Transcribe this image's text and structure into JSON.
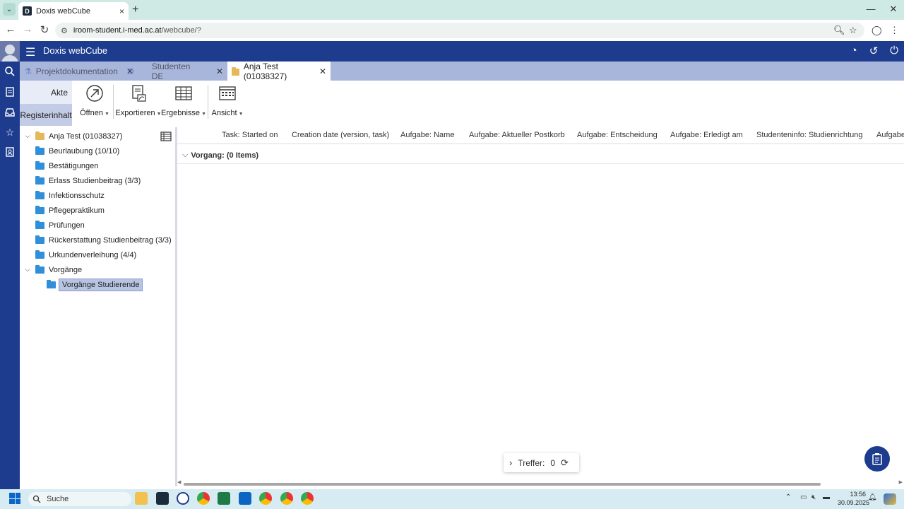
{
  "browser": {
    "tab_title": "Doxis webCube",
    "tab_close": "×",
    "new_tab": "+",
    "url_host": "iroom-student.i-med.ac.at",
    "url_path": "/webcube/?",
    "win_minimize": "—",
    "win_restore": "❐",
    "win_close": "✕"
  },
  "app": {
    "title": "Doxis webCube",
    "tabs": [
      {
        "label": "Projektdokumentation",
        "icon": "flask-icon"
      },
      {
        "label": "Studenten DE",
        "icon": "users-icon"
      },
      {
        "label": "Anja Test (01038327)",
        "icon": "folder-icon"
      }
    ]
  },
  "ribbon": {
    "tab_akte": "Akte",
    "tab_registerinhalt": "Registerinhalt",
    "buttons": [
      {
        "label": "Öffnen",
        "icon": "open-arrow-icon"
      },
      {
        "label": "Exportieren",
        "icon": "export-pdf-icon"
      },
      {
        "label": "Ergebnisse",
        "icon": "table-icon"
      },
      {
        "label": "Ansicht",
        "icon": "calendar-view-icon"
      }
    ]
  },
  "tree": {
    "root": "Anja Test (01038327)",
    "items": [
      "Beurlaubung (10/10)",
      "Bestätigungen",
      "Erlass Studienbeitrag (3/3)",
      "Infektionsschutz",
      "Pflegepraktikum",
      "Prüfungen",
      "Rückerstattung Studienbeitrag (3/3)",
      "Urkundenverleihung (4/4)",
      "Vorgänge"
    ],
    "selected_child": "Vorgänge Studierende"
  },
  "grid": {
    "columns": [
      "Task: Started on",
      "Creation date (version, task)",
      "Aufgabe: Name",
      "Aufgabe: Aktueller Postkorb",
      "Aufgabe: Entscheidung",
      "Aufgabe: Erledigt am",
      "Studenteninfo: Studienrichtung",
      "Aufgabe"
    ],
    "group_label": "Vorgang: (0 Items)"
  },
  "status": {
    "treffer_label": "Treffer:",
    "treffer_count": "0"
  },
  "taskbar": {
    "search_placeholder": "Suche",
    "time": "13:56",
    "date": "30.09.2025"
  },
  "colors": {
    "header_blue": "#1e3c8e",
    "tab_strip": "#a9b6dc",
    "folder_blue": "#2f8fd8",
    "browser_chrome": "#cfe9e4",
    "taskbar": "#d7ecf2"
  }
}
